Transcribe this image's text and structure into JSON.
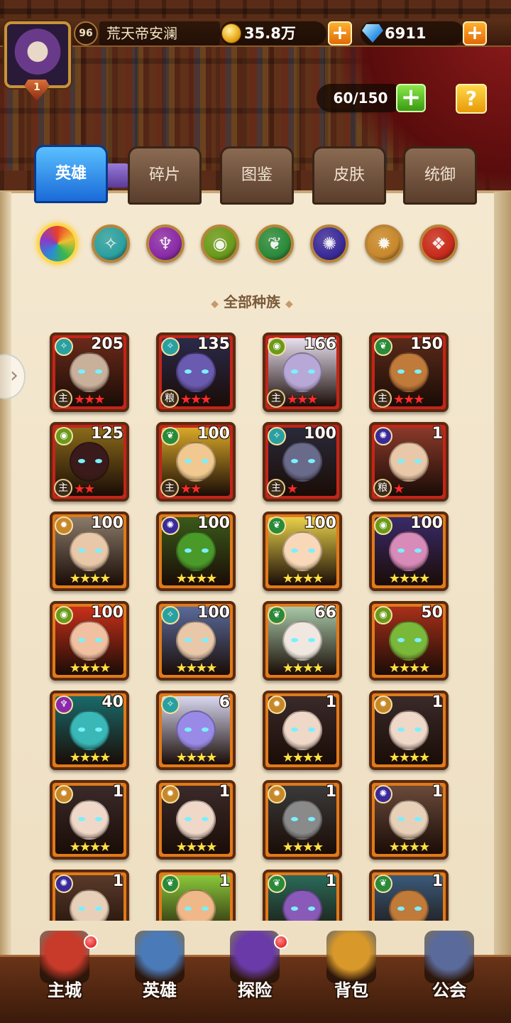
{
  "player": {
    "level": "96",
    "name": "荒天帝安澜",
    "rank": "1",
    "gold": "35.8万",
    "gems": "6911"
  },
  "hero_capacity": "60/150",
  "help_label": "?",
  "plus_label": "+",
  "tabs": [
    {
      "label": "英雄",
      "active": true
    },
    {
      "label": "碎片",
      "active": false
    },
    {
      "label": "图鉴",
      "active": false
    },
    {
      "label": "皮肤",
      "active": false
    },
    {
      "label": "统御",
      "active": false
    }
  ],
  "race_filter": {
    "selected_label": "全部种族",
    "races": [
      {
        "icon": "all-races-icon",
        "color": "#e84a2a"
      },
      {
        "icon": "fortress-race-icon",
        "color": "#2aa0a0"
      },
      {
        "icon": "abyss-race-icon",
        "color": "#8a2aa8"
      },
      {
        "icon": "forest-race-icon",
        "color": "#6a9a1a"
      },
      {
        "icon": "shadow-race-icon",
        "color": "#2a8a3a"
      },
      {
        "icon": "dark-race-icon",
        "color": "#3a2a9a"
      },
      {
        "icon": "light-race-icon",
        "color": "#c8882a"
      },
      {
        "icon": "chaos-race-icon",
        "color": "#c82a1a"
      }
    ]
  },
  "heroes": [
    {
      "level": "205",
      "race": "fortress",
      "role": "主",
      "stars": "★★★",
      "star_type": "red",
      "frame": "red",
      "skin": "#c8b09a",
      "bg": "#6a2a1a"
    },
    {
      "level": "135",
      "race": "fortress",
      "role": "粮",
      "stars": "★★★",
      "star_type": "red",
      "frame": "red",
      "skin": "#6a5ab0",
      "bg": "#2a2a4a"
    },
    {
      "level": "166",
      "race": "forest",
      "role": "主",
      "stars": "★★★",
      "star_type": "red",
      "frame": "red",
      "skin": "#b8a8d8",
      "bg": "#e8e0f0"
    },
    {
      "level": "150",
      "race": "shadow",
      "role": "主",
      "stars": "★★★",
      "star_type": "red",
      "frame": "red",
      "skin": "#c07a3a",
      "bg": "#5a2a1a"
    },
    {
      "level": "125",
      "race": "forest",
      "role": "主",
      "stars": "★★",
      "star_type": "red",
      "frame": "red",
      "skin": "#3a1a1a",
      "bg": "#8a6a1a"
    },
    {
      "level": "100",
      "race": "shadow",
      "role": "主",
      "stars": "★★",
      "star_type": "red",
      "frame": "red",
      "skin": "#f0c890",
      "bg": "#d8a828"
    },
    {
      "level": "100",
      "race": "fortress",
      "role": "主",
      "stars": "★",
      "star_type": "red",
      "frame": "red",
      "skin": "#6a6a8a",
      "bg": "#2a2a3a"
    },
    {
      "level": "1",
      "race": "dark",
      "role": "粮",
      "stars": "★",
      "star_type": "red",
      "frame": "red",
      "skin": "#e8c8a8",
      "bg": "#8a3a2a"
    },
    {
      "level": "100",
      "race": "light",
      "role": "",
      "stars": "★★★★",
      "star_type": "gold",
      "frame": "orange",
      "skin": "#e8c8a8",
      "bg": "#8a7a6a"
    },
    {
      "level": "100",
      "race": "dark",
      "role": "",
      "stars": "★★★★",
      "star_type": "gold",
      "frame": "orange",
      "skin": "#4a9a2a",
      "bg": "#3a5a1a"
    },
    {
      "level": "100",
      "race": "shadow",
      "role": "",
      "stars": "★★★★",
      "star_type": "gold",
      "frame": "orange",
      "skin": "#f8d8b8",
      "bg": "#e8d04a"
    },
    {
      "level": "100",
      "race": "forest",
      "role": "",
      "stars": "★★★★",
      "star_type": "gold",
      "frame": "orange",
      "skin": "#d88ab8",
      "bg": "#3a2a6a"
    },
    {
      "level": "100",
      "race": "forest",
      "role": "",
      "stars": "★★★★",
      "star_type": "gold",
      "frame": "orange",
      "skin": "#f0c0a0",
      "bg": "#c8301a"
    },
    {
      "level": "100",
      "race": "fortress",
      "role": "",
      "stars": "★★★★",
      "star_type": "gold",
      "frame": "orange",
      "skin": "#e8c8a8",
      "bg": "#5a6a9a"
    },
    {
      "level": "66",
      "race": "shadow",
      "role": "",
      "stars": "★★★★",
      "star_type": "gold",
      "frame": "orange",
      "skin": "#f0e8e0",
      "bg": "#a8c8a8"
    },
    {
      "level": "50",
      "race": "forest",
      "role": "",
      "stars": "★★★★",
      "star_type": "gold",
      "frame": "orange",
      "skin": "#7ab83a",
      "bg": "#a8301a"
    },
    {
      "level": "40",
      "race": "abyss",
      "role": "",
      "stars": "★★★★",
      "star_type": "gold",
      "frame": "orange",
      "skin": "#3ab8b8",
      "bg": "#1a6a6a"
    },
    {
      "level": "6",
      "race": "fortress",
      "role": "",
      "stars": "★★★★",
      "star_type": "gold",
      "frame": "orange",
      "skin": "#9a8ae8",
      "bg": "#d8d8f0"
    },
    {
      "level": "1",
      "race": "light",
      "role": "",
      "stars": "★★★★",
      "star_type": "gold",
      "frame": "orange",
      "skin": "#f0d8c8",
      "bg": "#3a2a2a"
    },
    {
      "level": "1",
      "race": "light",
      "role": "",
      "stars": "★★★★",
      "star_type": "gold",
      "frame": "orange",
      "skin": "#f0d8c8",
      "bg": "#3a2a2a"
    },
    {
      "level": "1",
      "race": "light",
      "role": "",
      "stars": "★★★★",
      "star_type": "gold",
      "frame": "orange",
      "skin": "#f0d8c8",
      "bg": "#3a2a2a"
    },
    {
      "level": "1",
      "race": "light",
      "role": "",
      "stars": "★★★★",
      "star_type": "gold",
      "frame": "orange",
      "skin": "#f0d8c8",
      "bg": "#3a2a2a"
    },
    {
      "level": "1",
      "race": "light",
      "role": "",
      "stars": "★★★★",
      "star_type": "gold",
      "frame": "orange",
      "skin": "#8a8a8a",
      "bg": "#3a3a3a"
    },
    {
      "level": "1",
      "race": "dark",
      "role": "",
      "stars": "★★★★",
      "star_type": "gold",
      "frame": "orange",
      "skin": "#e8d0b8",
      "bg": "#6a4a3a"
    },
    {
      "level": "1",
      "race": "dark",
      "role": "",
      "stars": "",
      "star_type": "gold",
      "frame": "orange",
      "skin": "#e8d0b8",
      "bg": "#5a3a2a"
    },
    {
      "level": "1",
      "race": "shadow",
      "role": "",
      "stars": "",
      "star_type": "gold",
      "frame": "orange",
      "skin": "#f0b888",
      "bg": "#8ac83a"
    },
    {
      "level": "1",
      "race": "shadow",
      "role": "",
      "stars": "",
      "star_type": "gold",
      "frame": "orange",
      "skin": "#8a5ab8",
      "bg": "#2a6a5a"
    },
    {
      "level": "1",
      "race": "shadow",
      "role": "",
      "stars": "",
      "star_type": "gold",
      "frame": "orange",
      "skin": "#c07a3a",
      "bg": "#3a5a7a"
    }
  ],
  "race_glyphs": {
    "fortress": "✧",
    "forest": "◉",
    "shadow": "❦",
    "dark": "✺",
    "light": "✹",
    "abyss": "♆"
  },
  "race_colors": {
    "fortress": "#2aa0a0",
    "forest": "#6a9a1a",
    "shadow": "#2a8a3a",
    "dark": "#3a2a9a",
    "light": "#c8882a",
    "abyss": "#8a2aa8"
  },
  "bottom_nav": [
    {
      "label": "主城",
      "icon": "castle-icon",
      "color": "#c83a2a",
      "badge": true
    },
    {
      "label": "英雄",
      "icon": "hero-icon",
      "color": "#4a7ab8",
      "badge": false
    },
    {
      "label": "探险",
      "icon": "portal-icon",
      "color": "#6a3aa8",
      "badge": true
    },
    {
      "label": "背包",
      "icon": "backpack-icon",
      "color": "#d8982a",
      "badge": false
    },
    {
      "label": "公会",
      "icon": "guild-icon",
      "color": "#5a6a9a",
      "badge": false
    }
  ]
}
